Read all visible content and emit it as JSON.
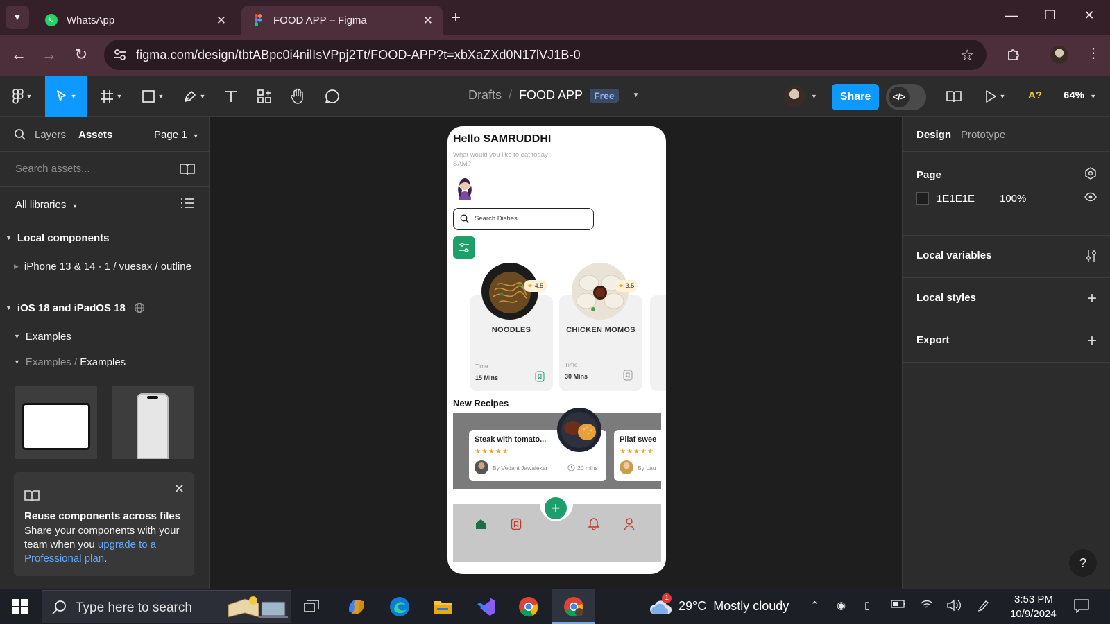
{
  "browser": {
    "tabs": [
      {
        "title": "WhatsApp",
        "icon": "whatsapp-icon"
      },
      {
        "title": "FOOD APP – Figma",
        "icon": "figma-icon"
      }
    ],
    "url": "figma.com/design/tbtABpc0i4nilIsVPpj2Tt/FOOD-APP?t=xbXaZXd0N17lVJ1B-0"
  },
  "toolbar": {
    "breadcrumb_drafts": "Drafts",
    "breadcrumb_sep": "/",
    "file_name": "FOOD APP",
    "plan_badge": "Free",
    "share_label": "Share",
    "zoom": "64%",
    "missing_fonts": "A?"
  },
  "left_panel": {
    "tab_layers": "Layers",
    "tab_assets": "Assets",
    "page_selector": "Page 1",
    "search_placeholder": "Search assets...",
    "libraries": "All libraries",
    "local_components": "Local components",
    "component_item": "iPhone 13 & 14 - 1 / vuesax / outline",
    "ios_library": "iOS 18 and iPadOS 18",
    "examples": "Examples",
    "examples_path_1": "Examples",
    "examples_path_sep": "/",
    "examples_path_2": "Examples",
    "promo_title": "Reuse components across files",
    "promo_body": "Share your components with your team when you",
    "promo_link": "upgrade to a Professional plan",
    "promo_end": "."
  },
  "phone": {
    "greeting": "Hello SAMRUDDHI",
    "subtitle": "What would you like to eat today SAM?",
    "search_placeholder": "Search Dishes",
    "cards": [
      {
        "name": "NOODLES",
        "rating": "4.5",
        "time_label": "Time",
        "time": "15 Mins"
      },
      {
        "name": "CHICKEN MOMOS",
        "rating": "3.5",
        "time_label": "Time",
        "time": "30 Mins"
      }
    ],
    "new_recipes": "New Recipes",
    "recipes": [
      {
        "title": "Steak with tomato...",
        "author": "By Vedant Jawalekar",
        "time": "20 mins",
        "stars": "★★★★★"
      },
      {
        "title": "Pilaf swee",
        "author": "By Lau",
        "stars": "★★★★★"
      }
    ],
    "fab": "+"
  },
  "right_panel": {
    "tab_design": "Design",
    "tab_prototype": "Prototype",
    "page_label": "Page",
    "page_color": "1E1E1E",
    "page_opacity": "100%",
    "local_variables": "Local variables",
    "local_styles": "Local styles",
    "export": "Export",
    "help": "?"
  },
  "taskbar": {
    "search_placeholder": "Type here to search",
    "weather": "29°C  Mostly cloudy",
    "weather_badge": "1",
    "time": "3:53 PM",
    "date": "10/9/2024"
  },
  "colors": {
    "figma_accent": "#0d99ff",
    "brand_green": "#1d9f6c",
    "nav_red": "#c0392b"
  }
}
